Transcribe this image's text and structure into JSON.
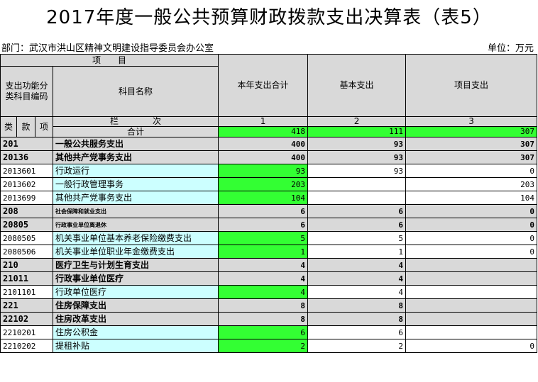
{
  "title": "2017年度一般公共预算财政拨款支出决算表（表5）",
  "department": "部门：武汉市洪山区精神文明建设指导委员会办公室",
  "unit": "单位：万元",
  "header": {
    "item": "项　　目",
    "func_code": "支出功能分类科目编码",
    "subject_name": "科目名称",
    "col_total": "本年支出合计",
    "col_basic": "基本支出",
    "col_project": "项目支出",
    "lei": "类",
    "kuan": "款",
    "xiang": "项",
    "lan_ci": "栏　　　　次",
    "n1": "1",
    "n2": "2",
    "n3": "3",
    "total_label": "合计",
    "total_1": "418",
    "total_2": "111",
    "total_3": "307"
  },
  "rows": [
    {
      "code": "201",
      "name": "一般公共服务支出",
      "total": "400",
      "basic": "93",
      "project": "307"
    },
    {
      "code": "20136",
      "name": "其他共产党事务支出",
      "total": "400",
      "basic": "93",
      "project": "307"
    },
    {
      "code": "2013601",
      "name": "行政运行",
      "total": "93",
      "basic": "93",
      "project": "0"
    },
    {
      "code": "2013602",
      "name": "一般行政管理事务",
      "total": "203",
      "basic": "",
      "project": "203"
    },
    {
      "code": "2013699",
      "name": "其他共产党事务支出",
      "total": "104",
      "basic": "",
      "project": "104"
    },
    {
      "code": "208",
      "name": "社会保障和就业支出",
      "total": "6",
      "basic": "6",
      "project": "0"
    },
    {
      "code": "20805",
      "name": "行政事业单位离退休",
      "total": "6",
      "basic": "6",
      "project": "0"
    },
    {
      "code": "2080505",
      "name": "机关事业单位基本养老保险缴费支出",
      "total": "5",
      "basic": "5",
      "project": "0"
    },
    {
      "code": "2080506",
      "name": "机关事业单位职业年金缴费支出",
      "total": "1",
      "basic": "1",
      "project": "0"
    },
    {
      "code": "210",
      "name": "医疗卫生与计划生育支出",
      "total": "4",
      "basic": "4",
      "project": ""
    },
    {
      "code": "21011",
      "name": "行政事业单位医疗",
      "total": "4",
      "basic": "4",
      "project": ""
    },
    {
      "code": "2101101",
      "name": "行政单位医疗",
      "total": "4",
      "basic": "4",
      "project": ""
    },
    {
      "code": "221",
      "name": "住房保障支出",
      "total": "8",
      "basic": "8",
      "project": ""
    },
    {
      "code": "22102",
      "name": "住房改革支出",
      "total": "8",
      "basic": "8",
      "project": ""
    },
    {
      "code": "2210201",
      "name": "住房公积金",
      "total": "6",
      "basic": "6",
      "project": ""
    },
    {
      "code": "2210202",
      "name": "提租补贴",
      "total": "2",
      "basic": "2",
      "project": "0"
    }
  ]
}
